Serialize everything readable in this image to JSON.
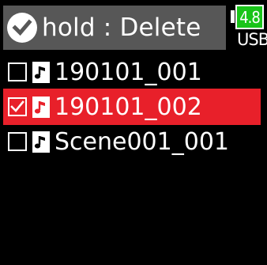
{
  "header": {
    "title": "hold : Delete",
    "icon": "check-circle-icon"
  },
  "status": {
    "battery_level": "4.8",
    "power_source": "USB",
    "battery_color": "#19c419"
  },
  "file_list": {
    "items": [
      {
        "label": "190101_001",
        "checked": false,
        "selected": false,
        "icon": "audio-file-icon"
      },
      {
        "label": "190101_002",
        "checked": true,
        "selected": true,
        "icon": "audio-file-icon"
      },
      {
        "label": "Scene001_001",
        "checked": false,
        "selected": false,
        "icon": "audio-file-icon"
      }
    ]
  },
  "colors": {
    "background": "#000000",
    "header_bg": "#575757",
    "selection": "#e8202a"
  }
}
